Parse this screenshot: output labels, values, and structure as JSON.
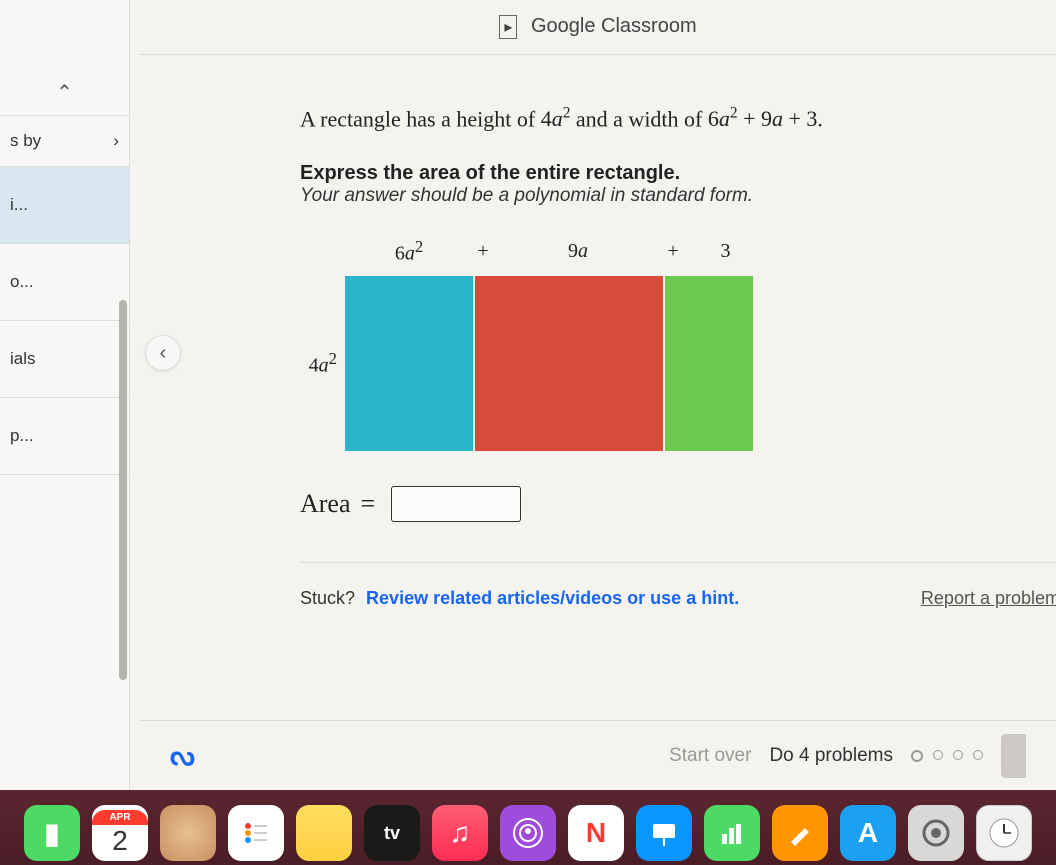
{
  "header": {
    "google_classroom": "Google Classroom"
  },
  "sidebar": {
    "section_label": "s by",
    "items": [
      "i...",
      "o...",
      "ials",
      "p..."
    ]
  },
  "problem": {
    "statement_pre": "A rectangle has a height of ",
    "height_expr": "4a²",
    "statement_mid": " and a width of ",
    "width_expr": "6a² + 9a + 3",
    "statement_end": ".",
    "instruction_bold": "Express the area of the entire rectangle.",
    "instruction_italic": "Your answer should be a polynomial in standard form."
  },
  "diagram": {
    "width_label_1": "6a²",
    "plus": "+",
    "width_label_2": "9a",
    "width_label_3": "3",
    "height_label": "4a²",
    "colors": {
      "cyan": "#2cb4c9",
      "red": "#d84a3a",
      "green": "#6bc950"
    }
  },
  "answer": {
    "label": "Area",
    "equals": "=",
    "value": ""
  },
  "stuck": {
    "label": "Stuck?",
    "link": "Review related articles/videos or use a hint.",
    "report": "Report a problem"
  },
  "bottom": {
    "start_over": "Start over",
    "do_problems": "Do 4 problems"
  },
  "dock": {
    "calendar_month": "APR",
    "calendar_day": "2",
    "tv": "tv",
    "music": "♫",
    "news": "N",
    "appstore": "A"
  }
}
